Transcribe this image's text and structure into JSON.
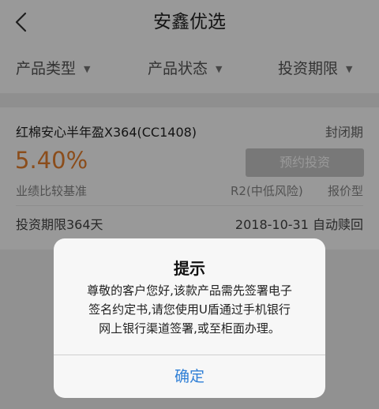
{
  "header": {
    "title": "安鑫优选",
    "back_icon": "chevron-left-icon"
  },
  "filters": [
    {
      "label": "产品类型",
      "icon": "caret-down-icon"
    },
    {
      "label": "产品状态",
      "icon": "caret-down-icon"
    },
    {
      "label": "投资期限",
      "icon": "caret-down-icon"
    }
  ],
  "product": {
    "name": "红棉安心半年盈X364(CC1408)",
    "status": "封闭期",
    "rate": "5.40%",
    "invest_button": "预约投资",
    "rate_label": "业绩比较基准",
    "risk": "R2(中低风险)",
    "type": "报价型",
    "term": "投资期限364天",
    "redeem": "2018-10-31 自动赎回"
  },
  "dialog": {
    "title": "提示",
    "message_lines": [
      "尊敬的客户您好,该款产品需先签署电子",
      "签名约定书,请您使用U盾通过手机银行",
      "网上银行渠道签署,或至柜面办理。"
    ],
    "confirm": "确定"
  },
  "colors": {
    "rate_orange": "#e8802e",
    "dialog_button_blue": "#2f7fd6",
    "disabled_button": "#c9c9c9"
  }
}
